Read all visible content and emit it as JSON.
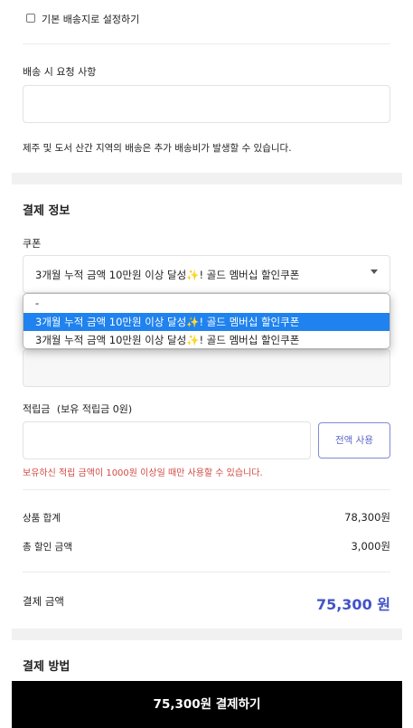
{
  "delivery": {
    "default_checkbox_label": "기본 배송지로 설정하기",
    "request_label": "배송 시 요청 사항",
    "request_value": "",
    "notice": "제주 및 도서 산간 지역의 배송은 추가 배송비가 발생할 수 있습니다."
  },
  "payment_info": {
    "title": "결제 정보",
    "coupon_label": "쿠폰",
    "coupon_selected": "3개월 누적 금액 10만원 이상 달성✨! 골드 멤버십 할인쿠폰",
    "coupon_options": [
      "-",
      "3개월 누적 금액 10만원 이상 달성✨! 골드 멤버십 할인쿠폰",
      "3개월 누적 금액 10만원 이상 달성✨! 골드 멤버십 할인쿠폰"
    ],
    "points_label": "적립금",
    "points_balance": "(보유 적립금 0원)",
    "points_value": "",
    "use_all_button": "전액 사용",
    "points_warning": "보유하신 적립 금액이 1000원 이상일 때만 사용할 수 있습니다."
  },
  "summary": {
    "subtotal_label": "상품 합계",
    "subtotal_value": "78,300원",
    "discount_label": "총 할인 금액",
    "discount_value": "3,000원",
    "total_label": "결제 금액",
    "total_value": "75,300 원"
  },
  "payment_method": {
    "title": "결제 방법"
  },
  "pay_button": "75,300원 결제하기",
  "colors": {
    "accent": "#4353c8",
    "warning": "#d24a43",
    "selected_option": "#1f82ee",
    "pay_button_bg": "#000000"
  }
}
